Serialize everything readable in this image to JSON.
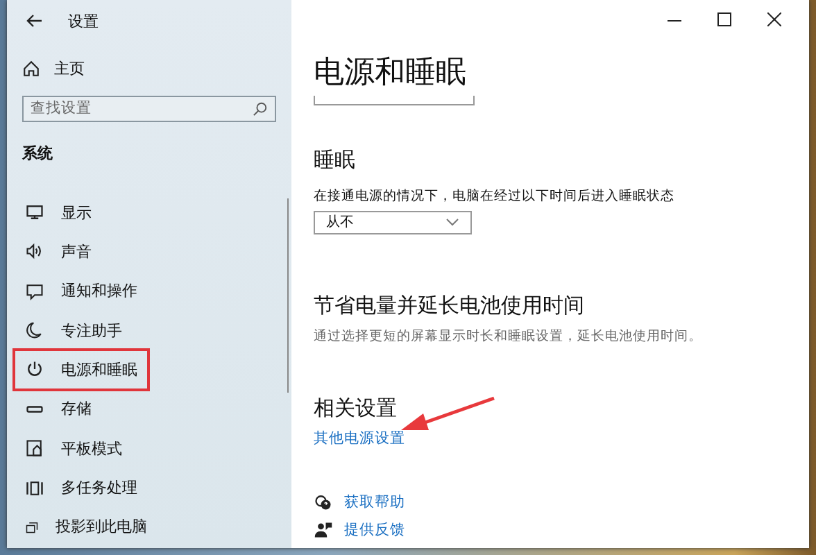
{
  "window": {
    "title": "设置"
  },
  "sidebar": {
    "home": "主页",
    "search": {
      "placeholder": "查找设置"
    },
    "section": "系统",
    "items": [
      {
        "label": "显示",
        "highlighted": false
      },
      {
        "label": "声音",
        "highlighted": false
      },
      {
        "label": "通知和操作",
        "highlighted": false
      },
      {
        "label": "专注助手",
        "highlighted": false
      },
      {
        "label": "电源和睡眠",
        "highlighted": true
      },
      {
        "label": "存储",
        "highlighted": false
      },
      {
        "label": "平板模式",
        "highlighted": false
      },
      {
        "label": "多任务处理",
        "highlighted": false
      },
      {
        "label": "投影到此电脑",
        "highlighted": false
      }
    ]
  },
  "page": {
    "title": "电源和睡眠",
    "sleep": {
      "heading": "睡眠",
      "description": "在接通电源的情况下，电脑在经过以下时间后进入睡眠状态",
      "dropdown": {
        "value": "从不"
      }
    },
    "battery": {
      "heading": "节省电量并延长电池使用时间",
      "description": "通过选择更短的屏幕显示时长和睡眠设置，延长电池使用时间。"
    },
    "related": {
      "heading": "相关设置",
      "links": [
        {
          "label": "其他电源设置",
          "pointed_at": true
        }
      ]
    },
    "help_links": [
      {
        "label": "获取帮助"
      },
      {
        "label": "提供反馈"
      }
    ]
  }
}
